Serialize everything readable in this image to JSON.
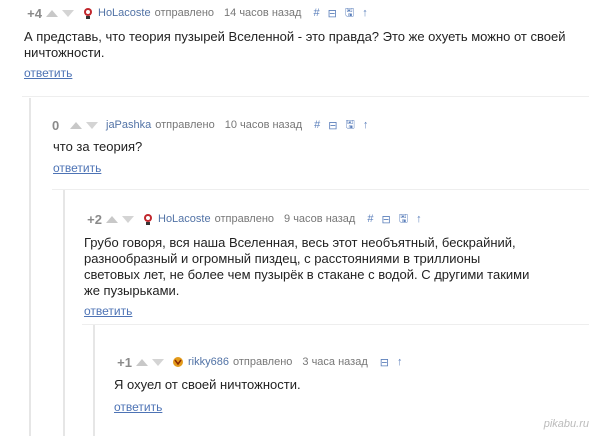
{
  "comments": [
    {
      "rating": "+4",
      "author": "HoLacoste",
      "sent": "отправлено",
      "time": "14 часов назад",
      "text": "А представь, что теория пузырей Вселенной - это правда? Это же охуеть можно от своей ничтожности.",
      "reply": "ответить",
      "actions": [
        "#",
        "⊟",
        "🖫",
        "↑"
      ]
    },
    {
      "rating": "0",
      "author": "jaPashka",
      "sent": "отправлено",
      "time": "10 часов назад",
      "text": "что за теория?",
      "reply": "ответить",
      "actions": [
        "#",
        "⊟",
        "🖫",
        "↑"
      ]
    },
    {
      "rating": "+2",
      "author": "HoLacoste",
      "sent": "отправлено",
      "time": "9 часов назад",
      "text": "Грубо говоря, вся наша Вселенная, весь этот необъятный, бескрайний, разнообразный и огромный пиздец, с расстояниями в триллионы световых лет, не более чем пузырёк в стакане с водой. С другими такими же пузырьками.",
      "reply": "ответить",
      "actions": [
        "#",
        "⊟",
        "🖫",
        "↑"
      ]
    },
    {
      "rating": "+1",
      "author": "rikky686",
      "sent": "отправлено",
      "time": "3 часа назад",
      "text": "Я охуел от своей ничтожности.",
      "reply": "ответить",
      "actions": [
        "⊟",
        "↑"
      ]
    }
  ],
  "watermark": "pikabu.ru",
  "colors": {
    "author": "#5273a6",
    "reply": "#4d73b5",
    "rating": "#8a8a8a"
  }
}
